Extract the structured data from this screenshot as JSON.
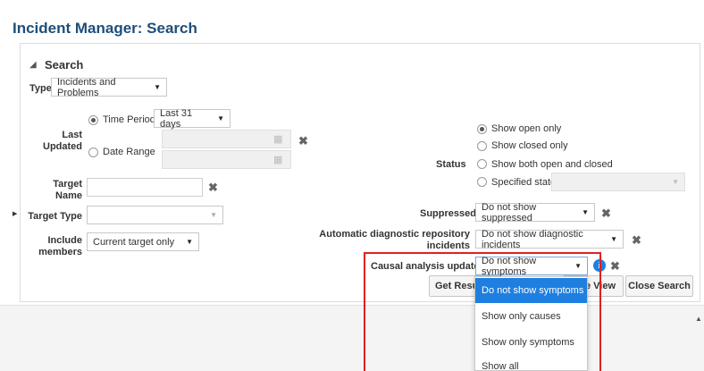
{
  "page": {
    "title": "Incident Manager: Search"
  },
  "search": {
    "heading": "Search",
    "type": {
      "label": "Type",
      "value": "Incidents and Problems"
    },
    "last_updated": {
      "label_line1": "Last",
      "label_line2": "Updated",
      "time_period_label": "Time Period",
      "time_period_value": "Last 31 days",
      "date_range_label": "Date Range"
    },
    "target_name": {
      "label_line1": "Target",
      "label_line2": "Name"
    },
    "target_type": {
      "label": "Target Type"
    },
    "include_members": {
      "label_line1": "Include",
      "label_line2": "members",
      "value": "Current target only"
    },
    "status": {
      "label": "Status",
      "options": [
        "Show open only",
        "Show closed only",
        "Show both open and closed",
        "Specified state"
      ],
      "selected": "Show open only"
    },
    "suppressed": {
      "label": "Suppressed",
      "value": "Do not show suppressed"
    },
    "adr": {
      "label_line1": "Automatic diagnostic repository",
      "label_line2": "incidents",
      "value": "Do not show diagnostic incidents"
    },
    "causal": {
      "label": "Causal analysis update",
      "value": "Do not show symptoms",
      "options": [
        "Do not show symptoms",
        "Show only causes",
        "Show only symptoms",
        "Show all"
      ]
    },
    "buttons": {
      "get_results": "Get Results",
      "save_view_partial": "e View",
      "close_search": "Close Search"
    }
  },
  "colors": {
    "title": "#1f4e79",
    "accent": "#1f7fe0",
    "highlight_box": "#e02020"
  }
}
